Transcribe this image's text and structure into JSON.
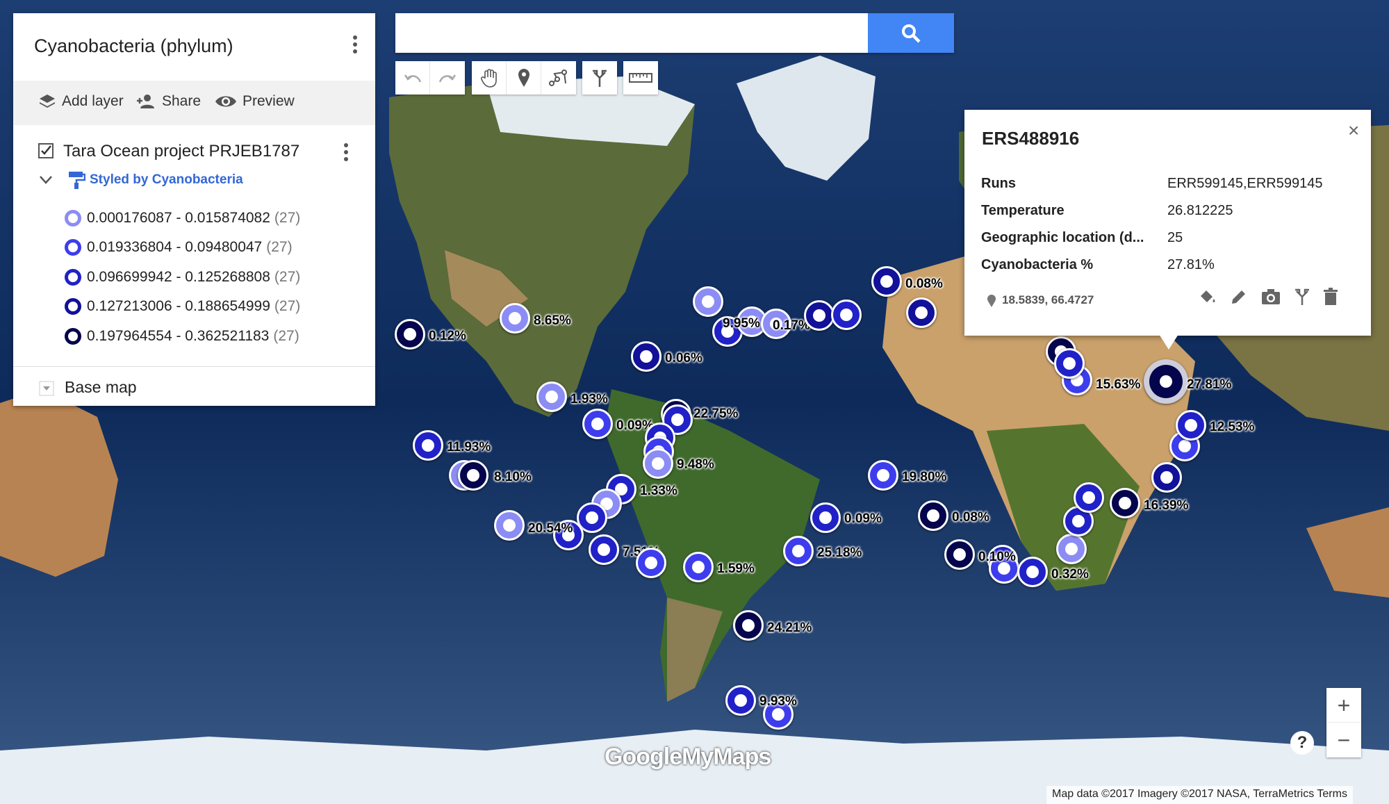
{
  "panel": {
    "title": "Cyanobacteria (phylum)",
    "toolbar": {
      "add_layer": "Add layer",
      "share": "Share",
      "preview": "Preview"
    },
    "layer": {
      "name": "Tara Ocean project PRJEB1787",
      "checked": true,
      "styled_by": "Styled by Cyanobacteria",
      "legend": [
        {
          "range": "0.000176087 - 0.015874082",
          "count": "(27)",
          "color": "#8c8cf5"
        },
        {
          "range": "0.019336804 - 0.09480047",
          "count": "(27)",
          "color": "#3d3dee"
        },
        {
          "range": "0.096699942 - 0.125268808",
          "count": "(27)",
          "color": "#2121c8"
        },
        {
          "range": "0.127213006 - 0.188654999",
          "count": "(27)",
          "color": "#111199"
        },
        {
          "range": "0.197964554 - 0.362521183",
          "count": "(27)",
          "color": "#05054d"
        }
      ]
    },
    "base_map": "Base map"
  },
  "search": {
    "placeholder": "",
    "value": ""
  },
  "popup": {
    "title": "ERS488916",
    "close": "×",
    "fields": [
      {
        "key": "Runs",
        "value": "ERR599145,ERR599145"
      },
      {
        "key": "Temperature",
        "value": "26.812225"
      },
      {
        "key": "Geographic location (d...",
        "value": "25"
      },
      {
        "key": "Cyanobacteria %",
        "value": "27.81%"
      }
    ],
    "coords": "18.5839, 66.4727"
  },
  "zoom": {
    "in": "+",
    "out": "−"
  },
  "help": "?",
  "logo": "GoogleMyMaps",
  "attribution": "Map data ©2017 Imagery ©2017 NASA, TerraMetrics    Terms",
  "map_labels": [
    "0.12%",
    "8.65%",
    "9.95%",
    "0.17%",
    "0.08%",
    "0.06%",
    "1.93%",
    "0.09%",
    "22.75%",
    "11.93%",
    "8.10%",
    "9.48%",
    "1.33%",
    "20.54%",
    "7.51%",
    "1.59%",
    "24.21%",
    "9.93%",
    "0.09%",
    "25.18%",
    "19.80%",
    "0.08%",
    "0.10%",
    "0.32%",
    "15.63%",
    "27.81%",
    "12.53%",
    "16.39%"
  ]
}
